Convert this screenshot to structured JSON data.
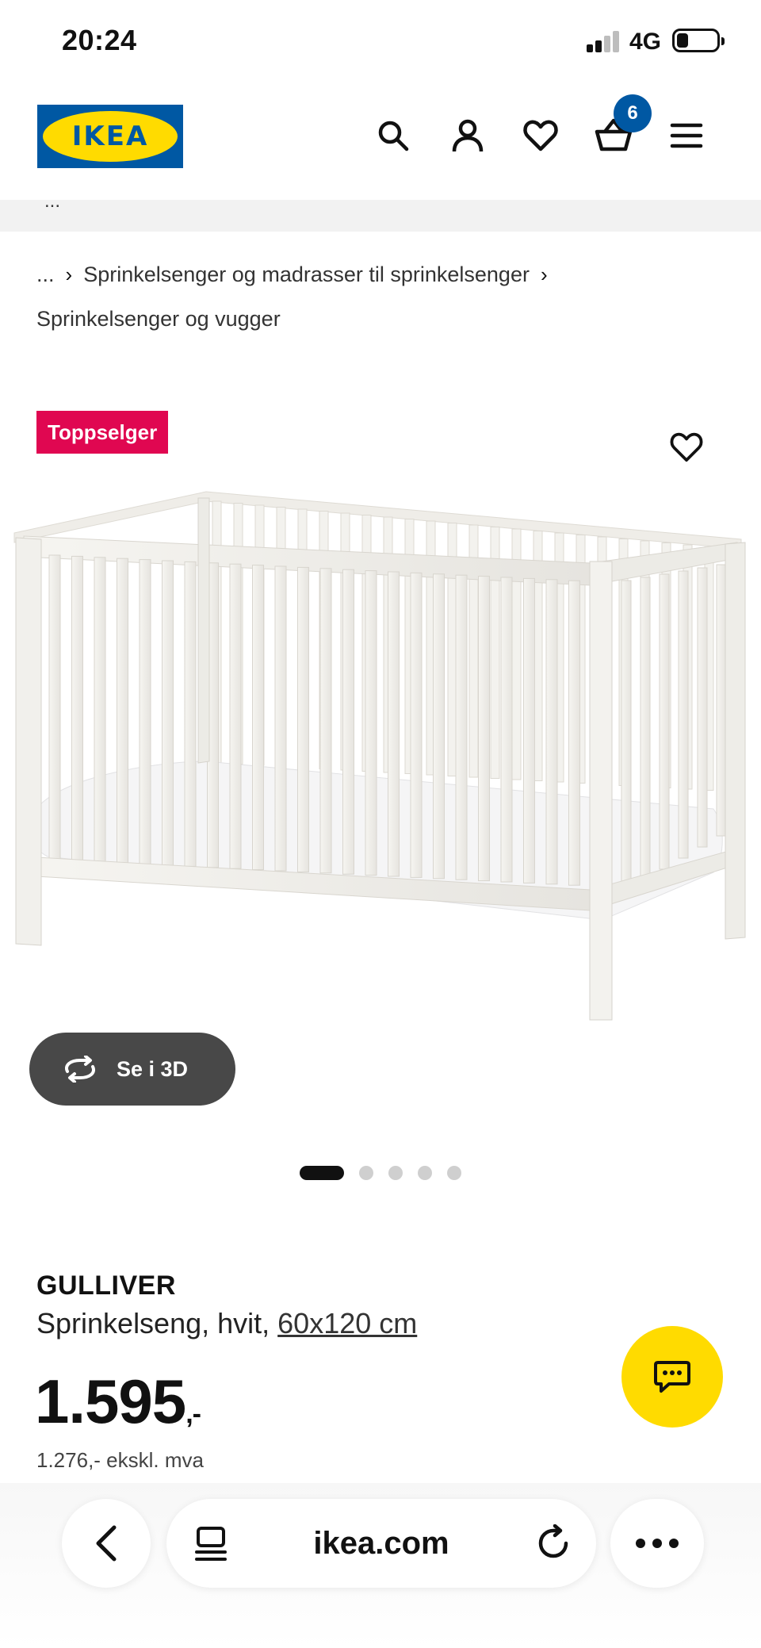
{
  "status_bar": {
    "time": "20:24",
    "network": "4G"
  },
  "header": {
    "logo_text": "IKEA",
    "cart_count": "6",
    "icons": [
      "search-icon",
      "account-icon",
      "heart-icon",
      "cart-icon",
      "menu-icon"
    ]
  },
  "strip": {
    "partial_text": "..."
  },
  "breadcrumb": {
    "ellipsis": "...",
    "items": [
      "Sprinkelsenger og madrasser til sprinkelsenger",
      "Sprinkelsenger og vugger"
    ]
  },
  "product": {
    "badge": "Toppselger",
    "view_3d_label": "Se i 3D",
    "carousel": {
      "total": 5,
      "active_index": 0
    },
    "name": "GULLIVER",
    "description": "Sprinkelseng, hvit, ",
    "size_link": "60x120 cm",
    "price_main": "1.595",
    "price_suffix": ",-",
    "price_ex_vat": "1.276,- ekskl. mva"
  },
  "browser": {
    "url": "ikea.com"
  },
  "colors": {
    "ikea_blue": "#0058a3",
    "ikea_yellow": "#ffdb00",
    "badge_red": "#e00751",
    "btn_3d_bg": "#484848"
  }
}
